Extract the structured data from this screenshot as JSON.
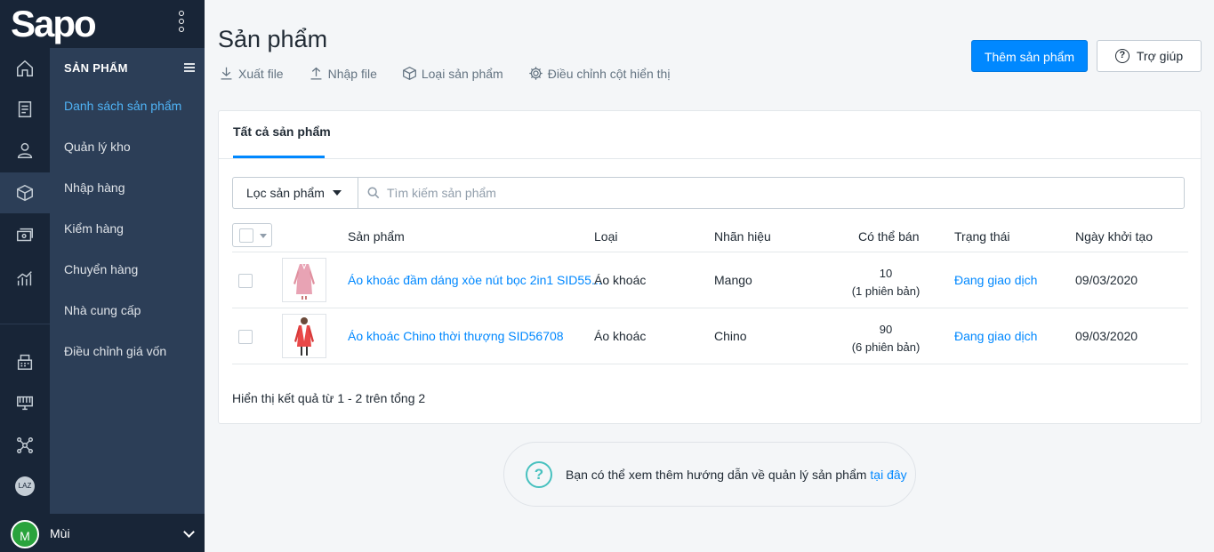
{
  "brand": {
    "logo": "Sapo"
  },
  "rail_icons": [
    "home-icon",
    "orders-icon",
    "customer-icon",
    "product-icon",
    "cashbook-icon",
    "report-icon",
    "pos-icon",
    "store-icon",
    "network-icon",
    "lazada-icon"
  ],
  "rail_lazada": "LAZ",
  "subnav": {
    "title": "SẢN PHẨM",
    "items": [
      "Danh sách sản phẩm",
      "Quản lý kho",
      "Nhập hàng",
      "Kiểm hàng",
      "Chuyển hàng",
      "Nhà cung cấp",
      "Điều chỉnh giá vốn"
    ]
  },
  "user": {
    "initial": "M",
    "name": "Mùi"
  },
  "page": {
    "title": "Sản phẩm",
    "actions": [
      "Xuất file",
      "Nhập file",
      "Loại sản phẩm",
      "Điều chỉnh cột hiển thị"
    ],
    "add_button": "Thêm sản phẩm",
    "help_button": "Trợ giúp"
  },
  "card": {
    "tab": "Tất cả sản phẩm",
    "filter_label": "Lọc sản phẩm",
    "search_placeholder": "Tìm kiếm sản phẩm",
    "columns": [
      "Sản phẩm",
      "Loại",
      "Nhãn hiệu",
      "Có thể bán",
      "Trạng thái",
      "Ngày khởi tạo"
    ],
    "rows": [
      {
        "name": "Áo khoác đầm dáng xòe nút bọc 2in1 SID55...",
        "type": "Áo khoác",
        "brand": "Mango",
        "qty": "10",
        "variants": "(1 phiên bản)",
        "status": "Đang giao dịch",
        "date": "09/03/2020"
      },
      {
        "name": "Áo khoác Chino thời thượng SID56708",
        "type": "Áo khoác",
        "brand": "Chino",
        "qty": "90",
        "variants": "(6 phiên bản)",
        "status": "Đang giao dịch",
        "date": "09/03/2020"
      }
    ],
    "footer": "Hiển thị kết quả từ 1 - 2 trên tổng 2"
  },
  "help": {
    "text": "Bạn có thể xem thêm hướng dẫn về quản lý sản phẩm",
    "link": "tại đây"
  },
  "colors": {
    "primary": "#0088ff",
    "sidebar_dark": "#182537",
    "sidebar": "#2c3e57",
    "teal": "#47c1bf"
  }
}
